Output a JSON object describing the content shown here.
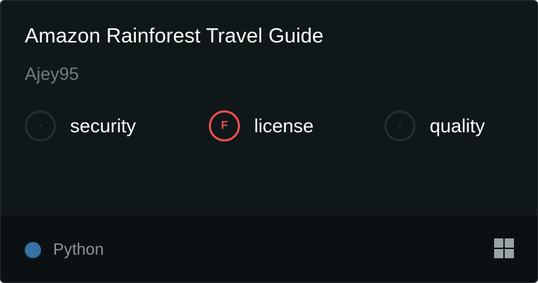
{
  "repo": {
    "title": "Amazon Rainforest Travel Guide",
    "owner": "Ajey95"
  },
  "metrics": [
    {
      "badge": "-",
      "label": "security",
      "status": "neutral"
    },
    {
      "badge": "F",
      "label": "license",
      "status": "fail"
    },
    {
      "badge": "-",
      "label": "quality",
      "status": "neutral"
    }
  ],
  "footer": {
    "language": "Python",
    "language_color": "#3572A5",
    "grid_icon": "grid-icon"
  },
  "colors": {
    "card_background": "#101719",
    "fail_red": "#ef4f4f"
  }
}
